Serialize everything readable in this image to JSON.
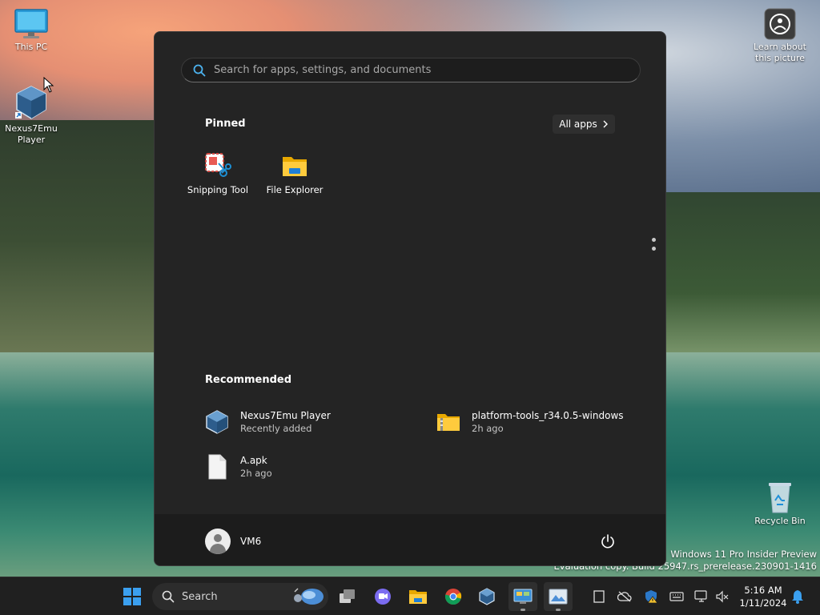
{
  "desktop": {
    "icons": [
      {
        "label": "This PC",
        "icon": "monitor-icon"
      },
      {
        "label": "Nexus7Emu Player",
        "icon": "virtualbox-cube-icon"
      },
      {
        "label": "Learn about this picture",
        "icon": "camera-info-icon"
      },
      {
        "label": "Recycle Bin",
        "icon": "recycle-bin-icon"
      }
    ],
    "watermark": {
      "line1": "Windows 11 Pro Insider Preview",
      "line2": "Evaluation copy. Build 25947.rs_prerelease.230901-1416"
    }
  },
  "start_menu": {
    "search": {
      "placeholder": "Search for apps, settings, and documents"
    },
    "pinned": {
      "title": "Pinned",
      "all_apps_label": "All apps",
      "apps": [
        {
          "label": "Snipping Tool",
          "icon": "snipping-tool-icon"
        },
        {
          "label": "File Explorer",
          "icon": "folder-icon"
        }
      ]
    },
    "recommended": {
      "title": "Recommended",
      "items": [
        {
          "name": "Nexus7Emu Player",
          "sub": "Recently added",
          "icon": "virtualbox-cube-icon"
        },
        {
          "name": "platform-tools_r34.0.5-windows",
          "sub": "2h ago",
          "icon": "zip-folder-icon"
        },
        {
          "name": "A.apk",
          "sub": "2h ago",
          "icon": "file-icon"
        }
      ]
    },
    "user": {
      "name": "VM6"
    }
  },
  "taskbar": {
    "search_label": "Search",
    "apps": [
      "start-icon",
      "task-view-icon",
      "teams-chat-icon",
      "file-explorer-icon",
      "chrome-icon",
      "virtualbox-icon",
      "control-panel-icon",
      "photos-icon"
    ],
    "tray": [
      "notepad-icon",
      "cloud-off-icon",
      "shield-warning-icon",
      "keyboard-icon",
      "network-icon",
      "speaker-muted-icon"
    ],
    "clock": {
      "time": "5:16 AM",
      "date": "1/11/2024"
    }
  },
  "colors": {
    "accent": "#0078d4",
    "menu_bg": "#242424",
    "taskbar_bg": "#202020"
  }
}
